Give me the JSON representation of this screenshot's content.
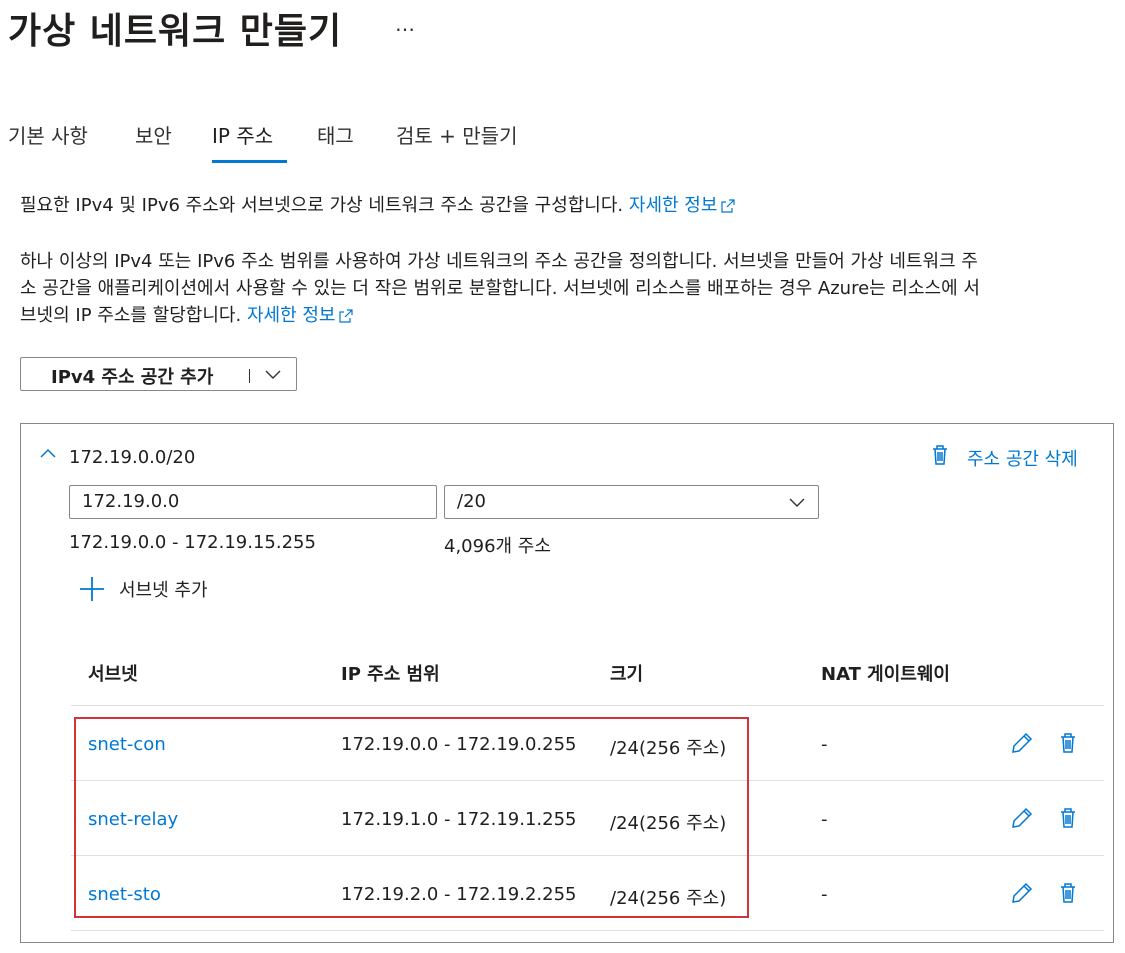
{
  "header": {
    "title": "가상 네트워크 만들기",
    "more_label": "…"
  },
  "tabs": [
    {
      "label": "기본 사항"
    },
    {
      "label": "보안"
    },
    {
      "label": "IP 주소",
      "active": true
    },
    {
      "label": "태그"
    },
    {
      "label": "검토 + 만들기"
    }
  ],
  "intro": {
    "line1_text": "필요한 IPv4 및 IPv6 주소와 서브넷으로 가상 네트워크 주소 공간을 구성합니다.",
    "line1_link": "자세한 정보",
    "para2_line1": "하나 이상의 IPv4 또는 IPv6 주소 범위를 사용하여 가상 네트워크의 주소 공간을 정의합니다. 서브넷을 만들어 가상 네트워크 주",
    "para2_line2": "소 공간을 애플리케이션에서 사용할 수 있는 더 작은 범위로 분할합니다. 서브넷에 리소스를 배포하는 경우 Azure는 리소스에 서",
    "para2_line3": "브넷의 IP 주소를 할당합니다.",
    "para2_link": "자세한 정보"
  },
  "add_space_button": {
    "label": "IPv4 주소 공간 추가"
  },
  "address_space": {
    "cidr": "172.19.0.0/20",
    "delete_label": "주소 공간 삭제",
    "address_value": "172.19.0.0",
    "prefix_value": "/20",
    "range_text": "172.19.0.0 - 172.19.15.255",
    "count_text": "4,096개 주소",
    "add_subnet_label": "서브넷 추가"
  },
  "subnet_table": {
    "columns": [
      "서브넷",
      "IP 주소 범위",
      "크기",
      "NAT 게이트웨이"
    ],
    "rows": [
      {
        "name": "snet-con",
        "range": "172.19.0.0 - 172.19.0.255",
        "size": "/24(256 주소)",
        "nat": "-"
      },
      {
        "name": "snet-relay",
        "range": "172.19.1.0 - 172.19.1.255",
        "size": "/24(256 주소)",
        "nat": "-"
      },
      {
        "name": "snet-sto",
        "range": "172.19.2.0 - 172.19.2.255",
        "size": "/24(256 주소)",
        "nat": "-"
      }
    ]
  },
  "colors": {
    "accent": "#0078d4",
    "highlight": "#d13438",
    "border": "#8a8886"
  }
}
